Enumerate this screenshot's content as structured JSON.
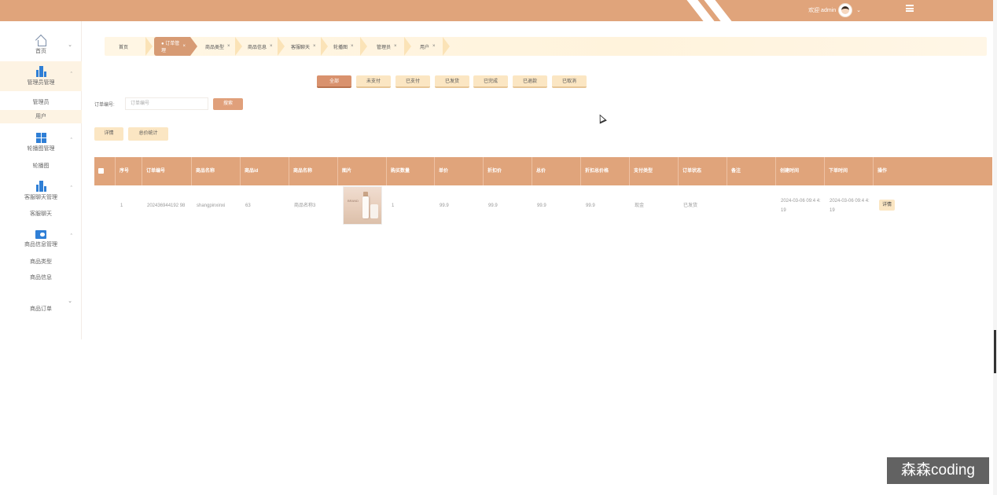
{
  "header": {
    "welcome_text": "欢迎 admin",
    "user_chevron": "⌄"
  },
  "sidebar": {
    "home_label": "首页",
    "groups": [
      {
        "label": "管理员管理",
        "icon": "building-icon",
        "items": [
          "管理员",
          "用户"
        ]
      },
      {
        "label": "轮播图管理",
        "icon": "grid-icon",
        "items": [
          "轮播图"
        ]
      },
      {
        "label": "客服聊天管理",
        "icon": "building-icon",
        "items": [
          "客服聊天"
        ]
      },
      {
        "label": "商品信息管理",
        "icon": "toggle-icon",
        "items": [
          "商品类型",
          "商品信息"
        ]
      },
      {
        "label": "商品订单",
        "icon": "",
        "items": []
      }
    ]
  },
  "tabs": [
    {
      "label": "首页",
      "active": false,
      "closable": false
    },
    {
      "label": "● 订单管理",
      "active": true,
      "closable": true
    },
    {
      "label": "商品类型",
      "active": false,
      "closable": true
    },
    {
      "label": "商品信息",
      "active": false,
      "closable": true
    },
    {
      "label": "客服聊天",
      "active": false,
      "closable": true
    },
    {
      "label": "轮播图",
      "active": false,
      "closable": true
    },
    {
      "label": "管理员",
      "active": false,
      "closable": true
    },
    {
      "label": "用户",
      "active": false,
      "closable": true
    }
  ],
  "tab_close_glyph": "×",
  "status_filters": [
    {
      "label": "全部",
      "active": true
    },
    {
      "label": "未支付",
      "active": false
    },
    {
      "label": "已支付",
      "active": false
    },
    {
      "label": "已发货",
      "active": false
    },
    {
      "label": "已完成",
      "active": false
    },
    {
      "label": "已退款",
      "active": false
    },
    {
      "label": "已取消",
      "active": false
    }
  ],
  "search": {
    "label": "订单编号:",
    "placeholder": "订单编号",
    "button_label": "搜索"
  },
  "actions": {
    "detail_label": "详情",
    "stats_label": "总价统计"
  },
  "table": {
    "columns": [
      "序号",
      "订单编号",
      "商品名称",
      "商品id",
      "商品名称",
      "图片",
      "购买数量",
      "单价",
      "折扣价",
      "总价",
      "折扣总价格",
      "支付类型",
      "订单状态",
      "备注",
      "创建时间",
      "下单时间",
      "操作"
    ],
    "rows": [
      {
        "index": "1",
        "order_no": "202436944192 98",
        "goods_name": "shangpinxinxi",
        "goods_id": "63",
        "product_name": "商品名称3",
        "image_caption": "BRAND",
        "quantity": "1",
        "unit_price": "99.9",
        "discount_price": "99.9",
        "total_price": "99.9",
        "discount_total": "99.9",
        "pay_type": "现金",
        "status": "已发货",
        "remark": "",
        "created_at": "2024-03-06 09:4 4:19",
        "ordered_at": "2024-03-06 09:4 4:19",
        "operation_label": "详情"
      }
    ]
  },
  "watermark": "森森coding",
  "colors": {
    "primary": "#e0a47b",
    "tab_bg": "#fff6e4",
    "button_light": "#fbe6c3",
    "active_filter": "#d9926e"
  }
}
